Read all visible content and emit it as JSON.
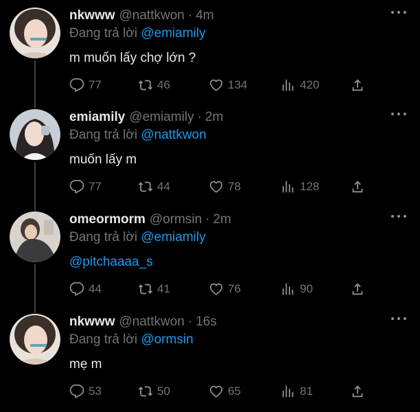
{
  "colors": {
    "background": "#000000",
    "primary_text": "#e7e9ea",
    "secondary_text": "#71767b",
    "link": "#1d9bf0",
    "thread_line": "#3d4145"
  },
  "icons": {
    "more": "more-horizontal-icon",
    "reply": "speech-bubble-icon",
    "retweet": "retweet-arrows-icon",
    "like": "heart-icon",
    "views": "bar-chart-icon",
    "share": "share-upload-icon"
  },
  "tweets": [
    {
      "name": "nkwww",
      "handle": "@nattkwon",
      "dot": "·",
      "time": "4m",
      "replying_prefix": "Đang trả lời ",
      "replying_to": "@emiamily",
      "text": "m muốn lấy chợ lớn ?",
      "replies": "77",
      "retweets": "46",
      "likes": "134",
      "views": "420"
    },
    {
      "name": "emiamily",
      "handle": "@emiamily",
      "dot": "·",
      "time": "2m",
      "replying_prefix": "Đang trả lời ",
      "replying_to": "@nattkwon",
      "text": "muốn lấy m",
      "replies": "77",
      "retweets": "44",
      "likes": "78",
      "views": "128"
    },
    {
      "name": "omeormorm",
      "handle": "@ormsin",
      "dot": "·",
      "time": "2m",
      "replying_prefix": "Đang trả lời ",
      "replying_to": "@emiamily",
      "text": "@pitchaaaa_s",
      "replies": "44",
      "retweets": "41",
      "likes": "76",
      "views": "90"
    },
    {
      "name": "nkwww",
      "handle": "@nattkwon",
      "dot": "·",
      "time": "16s",
      "replying_prefix": "Đang trả lời ",
      "replying_to": "@ormsin",
      "text": "mẹ m",
      "replies": "53",
      "retweets": "50",
      "likes": "65",
      "views": "81"
    }
  ]
}
